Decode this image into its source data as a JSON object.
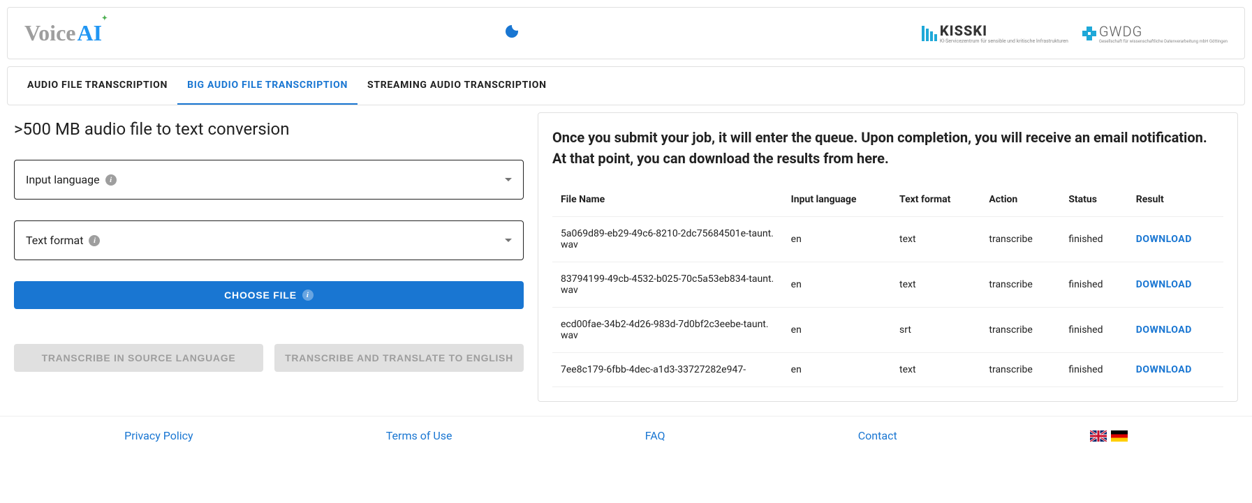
{
  "header": {
    "logo_main": "Voice",
    "logo_accent": "AI",
    "partner1": "KISSKI",
    "partner1_sub": "KI-Servicezentrum für sensible und kritische Infrastrukturen",
    "partner2": "GWDG",
    "partner2_sub": "Gesellschaft für wissenschaftliche Datenverarbeitung mbH Göttingen"
  },
  "tabs": [
    {
      "label": "AUDIO FILE TRANSCRIPTION",
      "active": false
    },
    {
      "label": "BIG AUDIO FILE TRANSCRIPTION",
      "active": true
    },
    {
      "label": "STREAMING AUDIO TRANSCRIPTION",
      "active": false
    }
  ],
  "left": {
    "title": ">500 MB audio file to text conversion",
    "input_language_label": "Input language",
    "text_format_label": "Text format",
    "choose_file": "CHOOSE FILE",
    "transcribe_source": "TRANSCRIBE IN SOURCE LANGUAGE",
    "transcribe_translate": "TRANSCRIBE AND TRANSLATE TO ENGLISH"
  },
  "right": {
    "info": "Once you submit your job, it will enter the queue. Upon completion, you will receive an email notification. At that point, you can download the results from here.",
    "columns": {
      "file_name": "File Name",
      "input_language": "Input language",
      "text_format": "Text format",
      "action": "Action",
      "status": "Status",
      "result": "Result"
    },
    "download_label": "DOWNLOAD",
    "rows": [
      {
        "file": "5a069d89-eb29-49c6-8210-2dc75684501e-taunt.wav",
        "lang": "en",
        "fmt": "text",
        "action": "transcribe",
        "status": "finished"
      },
      {
        "file": "83794199-49cb-4532-b025-70c5a53eb834-taunt.wav",
        "lang": "en",
        "fmt": "text",
        "action": "transcribe",
        "status": "finished"
      },
      {
        "file": "ecd00fae-34b2-4d26-983d-7d0bf2c3eebe-taunt.wav",
        "lang": "en",
        "fmt": "srt",
        "action": "transcribe",
        "status": "finished"
      },
      {
        "file": "7ee8c179-6fbb-4dec-a1d3-33727282e947-",
        "lang": "en",
        "fmt": "text",
        "action": "transcribe",
        "status": "finished"
      }
    ]
  },
  "footer": {
    "privacy": "Privacy Policy",
    "terms": "Terms of Use",
    "faq": "FAQ",
    "contact": "Contact"
  }
}
